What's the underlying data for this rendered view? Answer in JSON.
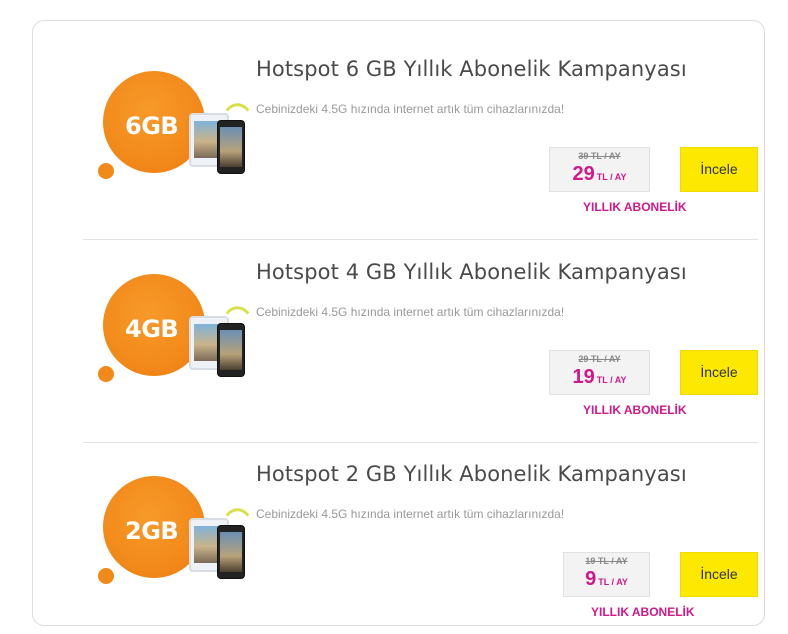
{
  "offers": [
    {
      "gb": "6GB",
      "title": "Hotspot 6 GB Yıllık Abonelik Kampanyası",
      "desc": "Cebinizdeki 4.5G hızında internet artık tüm cihazlarınızda!",
      "old_price": "39 TL / AY",
      "price": "29",
      "unit": "TL / AY",
      "button": "İncele",
      "tag": "YILLIK ABONELİK"
    },
    {
      "gb": "4GB",
      "title": "Hotspot 4 GB Yıllık Abonelik Kampanyası",
      "desc": "Cebinizdeki 4.5G hızında internet artık tüm cihazlarınızda!",
      "old_price": "29 TL / AY",
      "price": "19",
      "unit": "TL / AY",
      "button": "İncele",
      "tag": "YILLIK ABONELİK"
    },
    {
      "gb": "2GB",
      "title": "Hotspot 2 GB Yıllık Abonelik Kampanyası",
      "desc": "Cebinizdeki 4.5G hızında internet artık tüm cihazlarınızda!",
      "old_price": "19 TL / AY",
      "price": "9",
      "unit": "TL / AY",
      "button": "İncele",
      "tag": "YILLIK ABONELİK"
    }
  ],
  "colors": {
    "accent_magenta": "#d0188a",
    "button_yellow": "#fce800",
    "blob_orange": "#f28a1a"
  }
}
